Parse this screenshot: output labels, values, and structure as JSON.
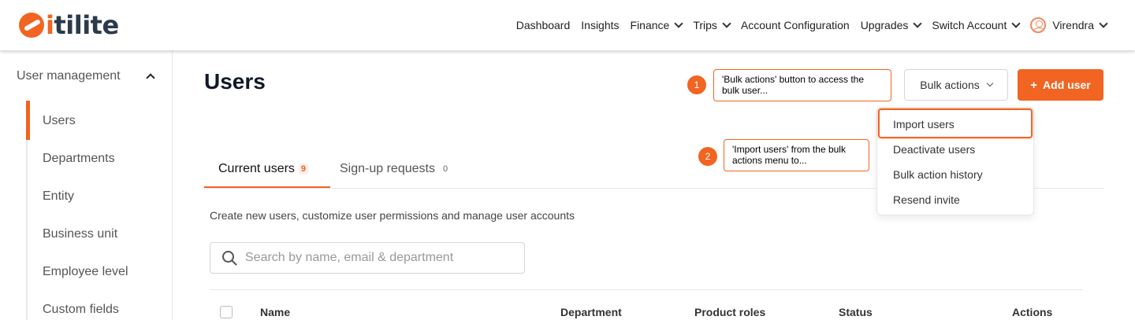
{
  "brand": {
    "logo_i": "i",
    "logo_rest": "tilite",
    "accent": "#f26422"
  },
  "nav": {
    "items": [
      {
        "label": "Dashboard",
        "dropdown": false
      },
      {
        "label": "Insights",
        "dropdown": false
      },
      {
        "label": "Finance",
        "dropdown": true
      },
      {
        "label": "Trips",
        "dropdown": true
      },
      {
        "label": "Account Configuration",
        "dropdown": false
      },
      {
        "label": "Upgrades",
        "dropdown": true
      },
      {
        "label": "Switch Account",
        "dropdown": true
      }
    ],
    "user": "Virendra"
  },
  "sidebar": {
    "section": "User management",
    "items": [
      "Users",
      "Departments",
      "Entity",
      "Business unit",
      "Employee level",
      "Custom fields"
    ],
    "active": "Users"
  },
  "main": {
    "title": "Users",
    "bulk_actions_label": "Bulk actions",
    "add_user_label": "Add user",
    "add_user_icon": "+",
    "bulk_menu": [
      "Import users",
      "Deactivate users",
      "Bulk action history",
      "Resend invite"
    ],
    "tabs": [
      {
        "label": "Current users",
        "count": "9"
      },
      {
        "label": "Sign-up requests",
        "count": "0"
      }
    ],
    "description": "Create new users, customize user permissions and manage user accounts",
    "search_placeholder": "Search by name, email & department",
    "columns": [
      "Name",
      "Department",
      "Product roles",
      "Status",
      "Actions"
    ]
  },
  "annotations": [
    {
      "number": "1",
      "line1": "'Bulk actions' button to access the",
      "line2": "bulk user..."
    },
    {
      "number": "2",
      "line1": "'Import users' from the bulk",
      "line2": "actions menu to..."
    }
  ]
}
